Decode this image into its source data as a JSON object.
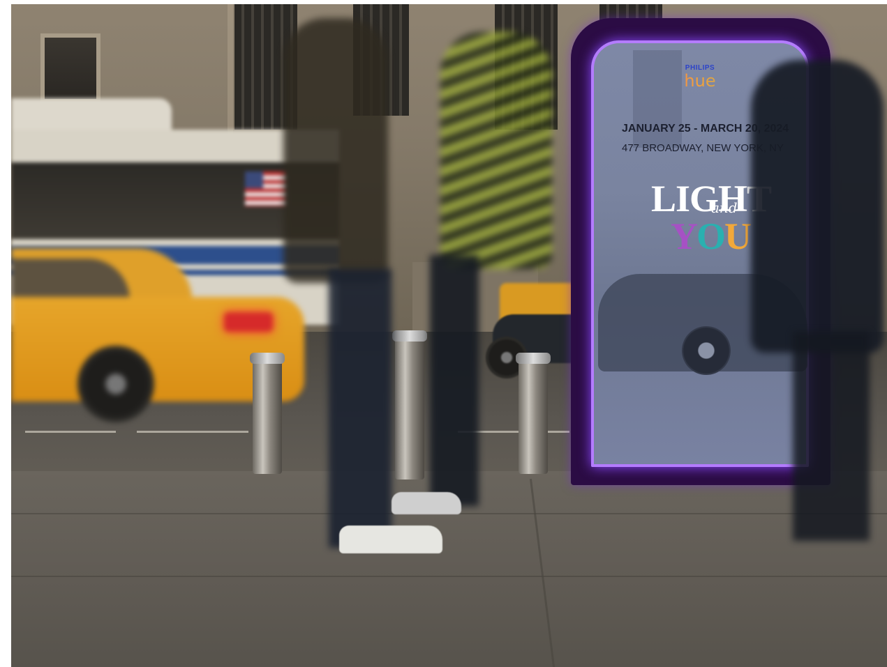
{
  "scene": {
    "description_tags": [
      "street",
      "taxi",
      "bus",
      "kiosk",
      "pedestrians"
    ]
  },
  "ad": {
    "brand_small": "PHILIPS",
    "brand_large": "hue",
    "dates": "JANUARY 25 - MARCH 20, 2024",
    "address": "477 BROADWAY, NEW YORK, NY",
    "title_light": "LIGHT",
    "title_and": "and",
    "title_you_y": "Y",
    "title_you_o": "O",
    "title_you_u": "U",
    "colors": {
      "frame": "#2b0c44",
      "neon": "#b47cff",
      "you_y": "#a651c4",
      "you_o": "#2ab0b0",
      "you_u": "#f2a83a"
    }
  }
}
